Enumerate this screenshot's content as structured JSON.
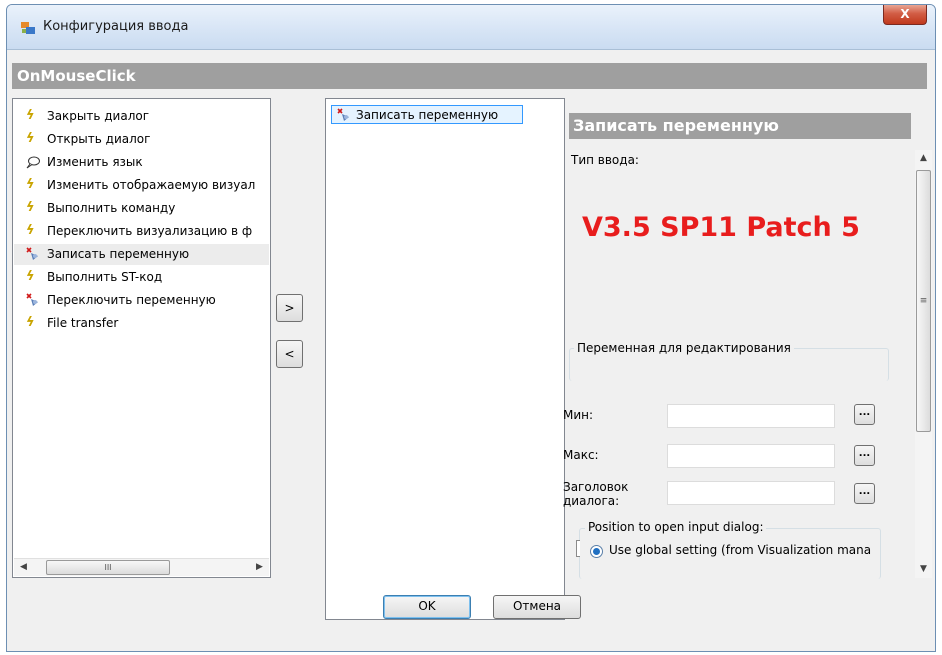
{
  "window": {
    "title": "Конфигурация ввода",
    "close_label": "X"
  },
  "event_header": "OnMouseClick",
  "actions": [
    {
      "label": "Закрыть диалог",
      "icon": "lightning-icon"
    },
    {
      "label": "Открыть диалог",
      "icon": "lightning-icon"
    },
    {
      "label": "Изменить язык",
      "icon": "speech-bubble-icon"
    },
    {
      "label": "Изменить отображаемую визуал",
      "icon": "lightning-icon"
    },
    {
      "label": "Выполнить команду",
      "icon": "lightning-icon"
    },
    {
      "label": "Переключить визуализацию в ф",
      "icon": "lightning-icon"
    },
    {
      "label": "Записать переменную",
      "icon": "write-variable-icon",
      "selected": true
    },
    {
      "label": "Выполнить ST-код",
      "icon": "lightning-icon"
    },
    {
      "label": "Переключить переменную",
      "icon": "write-variable-icon"
    },
    {
      "label": "File transfer",
      "icon": "lightning-icon"
    }
  ],
  "transfer": {
    "add_label": ">",
    "remove_label": "<"
  },
  "selected_actions": [
    {
      "label": "Записать переменную",
      "icon": "write-variable-icon"
    }
  ],
  "details": {
    "title": "Записать переменную",
    "input_type_label": "Тип ввода:",
    "version_note": "V3.5 SP11 Patch 5",
    "variable_group_label": "Переменная для редактирования",
    "min_label": "Мин:",
    "max_label": "Макс:",
    "dialog_title_label": "Заголовок диалога:",
    "min_value": "",
    "max_value": "",
    "dialog_title_value": "",
    "dots_label": "...",
    "position_group_label": "Position to open input dialog:",
    "radio_label": "Use global setting (from Visualization mana"
  },
  "footer": {
    "ok_label": "OK",
    "cancel_label": "Отмена"
  },
  "colors": {
    "header_gray": "#9f9f9f",
    "watermark_red": "#e81d1d",
    "selection_blue": "#3399ff"
  }
}
